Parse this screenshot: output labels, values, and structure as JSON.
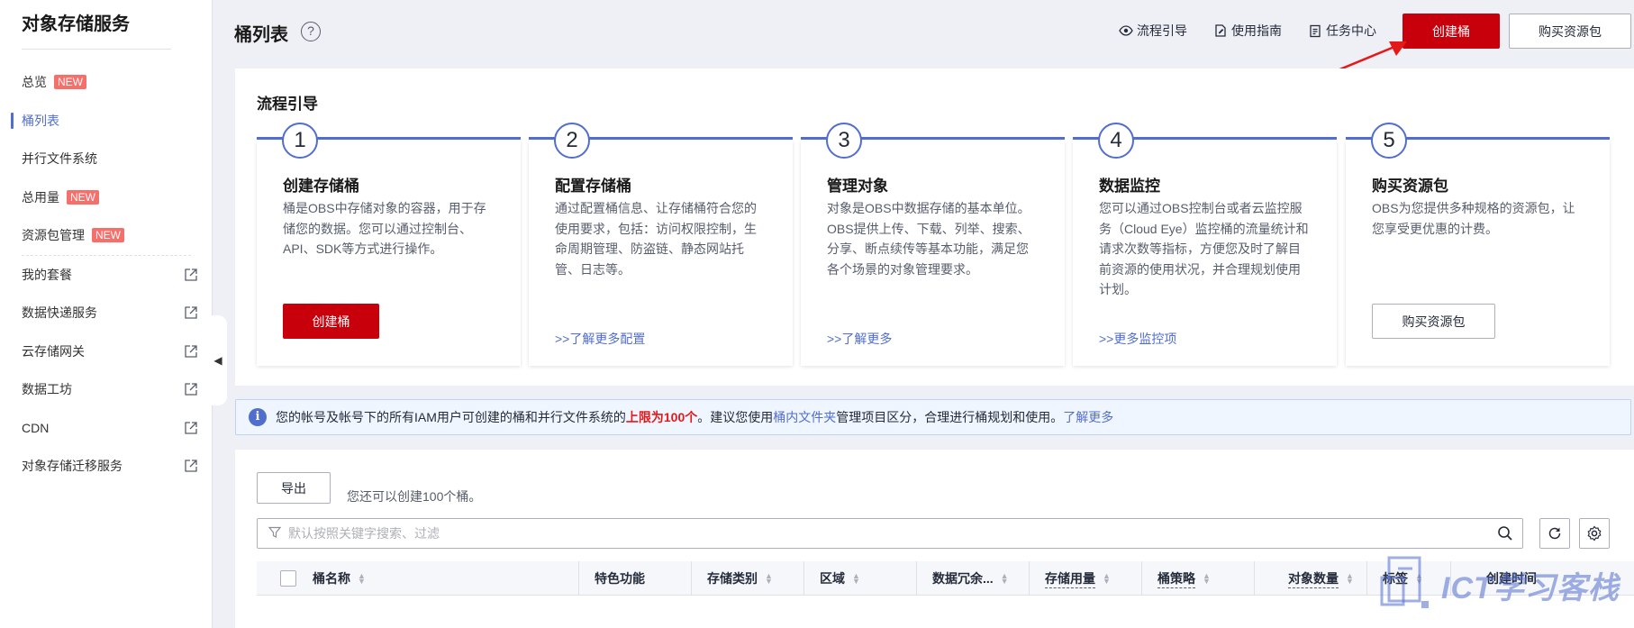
{
  "sidebar": {
    "title": "对象存储服务",
    "items": [
      {
        "label": "总览",
        "badge": "NEW",
        "external": false,
        "active": false
      },
      {
        "label": "桶列表",
        "badge": "",
        "external": false,
        "active": true
      },
      {
        "label": "并行文件系统",
        "badge": "",
        "external": false,
        "active": false
      },
      {
        "label": "总用量",
        "badge": "NEW",
        "external": false,
        "active": false
      },
      {
        "label": "资源包管理",
        "badge": "NEW",
        "external": false,
        "active": false
      },
      {
        "label": "我的套餐",
        "badge": "",
        "external": true,
        "active": false
      },
      {
        "label": "数据快递服务",
        "badge": "",
        "external": true,
        "active": false
      },
      {
        "label": "云存储网关",
        "badge": "",
        "external": true,
        "active": false
      },
      {
        "label": "数据工坊",
        "badge": "",
        "external": true,
        "active": false
      },
      {
        "label": "CDN",
        "badge": "",
        "external": true,
        "active": false
      },
      {
        "label": "对象存储迁移服务",
        "badge": "",
        "external": true,
        "active": false
      }
    ]
  },
  "header": {
    "title": "桶列表",
    "help_icon": "?",
    "links": {
      "process_guide": "流程引导",
      "user_guide": "使用指南",
      "task_center": "任务中心"
    },
    "create_bucket": "创建桶",
    "buy_package": "购买资源包"
  },
  "guide": {
    "title": "流程引导",
    "steps": [
      {
        "num": "1",
        "title": "创建存储桶",
        "desc": "桶是OBS中存储对象的容器，用于存储您的数据。您可以通过控制台、API、SDK等方式进行操作。",
        "action": "创建桶",
        "link": ""
      },
      {
        "num": "2",
        "title": "配置存储桶",
        "desc": "通过配置桶信息、让存储桶符合您的使用要求，包括：访问权限控制，生命周期管理、防盗链、静态网站托管、日志等。",
        "action": "",
        "link": ">>了解更多配置"
      },
      {
        "num": "3",
        "title": "管理对象",
        "desc": "对象是OBS中数据存储的基本单位。OBS提供上传、下载、列举、搜索、分享、断点续传等基本功能，满足您各个场景的对象管理要求。",
        "action": "",
        "link": ">>了解更多"
      },
      {
        "num": "4",
        "title": "数据监控",
        "desc": "您可以通过OBS控制台或者云监控服务（Cloud Eye）监控桶的流量统计和请求次数等指标，方便您及时了解目前资源的使用状况，并合理规划使用计划。",
        "action": "",
        "link": ">>更多监控项"
      },
      {
        "num": "5",
        "title": "购买资源包",
        "desc": "OBS为您提供多种规格的资源包，让您享受更优惠的计费。",
        "action": "购买资源包",
        "link": ""
      }
    ]
  },
  "info": {
    "text1": "您的帐号及帐号下的所有IAM用户可创建的桶和并行文件系统的",
    "limit": "上限为100个",
    "text2": "。建议您使用",
    "folder_link": "桶内文件夹",
    "text3": "管理项目区分，合理进行桶规划和使用。",
    "more_link": "了解更多"
  },
  "table": {
    "export": "导出",
    "quota": "您还可以创建100个桶。",
    "search_placeholder": "默认按照关键字搜索、过滤",
    "columns": [
      "桶名称",
      "特色功能",
      "存储类别",
      "区域",
      "数据冗余...",
      "存储用量",
      "桶策略",
      "对象数量",
      "标签",
      "创建时间"
    ]
  },
  "watermark": "ICT学习客栈",
  "colors": {
    "primary": "#c7000b",
    "link": "#526ecc",
    "annotation": "#e5181a"
  }
}
